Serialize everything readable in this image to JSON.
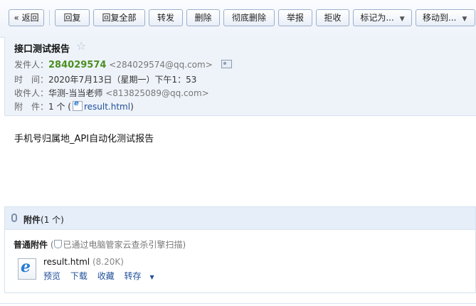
{
  "toolbar": {
    "back": "« 返回",
    "reply": "回复",
    "reply_all": "回复全部",
    "forward": "转发",
    "delete": "删除",
    "delete_forever": "彻底删除",
    "report": "举报",
    "reject": "拒收",
    "mark_as": "标记为...",
    "move_to": "移动到..."
  },
  "mail": {
    "subject": "接口测试报告",
    "sender_label": "发件人：",
    "sender_name": "284029574",
    "sender_email": "<284029574@qq.com>",
    "time_label": "时　间：",
    "time_value": "2020年7月13日（星期一）下午1：53",
    "to_label": "收件人：",
    "to_name": "华测-当当老师",
    "to_email": "<813825089@qq.com>",
    "attach_label": "附　件：",
    "attach_count": "1 个 (",
    "attach_file": "result.html",
    "attach_close": ")",
    "body": "手机号归属地_API自动化测试报告"
  },
  "attachments": {
    "title": "附件",
    "count": "(1 个)",
    "section_label": "普通附件",
    "scan_note": "已通过电脑管家云查杀引擎扫描)",
    "scan_open": "(",
    "file_name": "result.html",
    "file_size": "(8.20K)",
    "preview": "预览",
    "download": "下载",
    "favorite": "收藏",
    "save_to": "转存"
  }
}
